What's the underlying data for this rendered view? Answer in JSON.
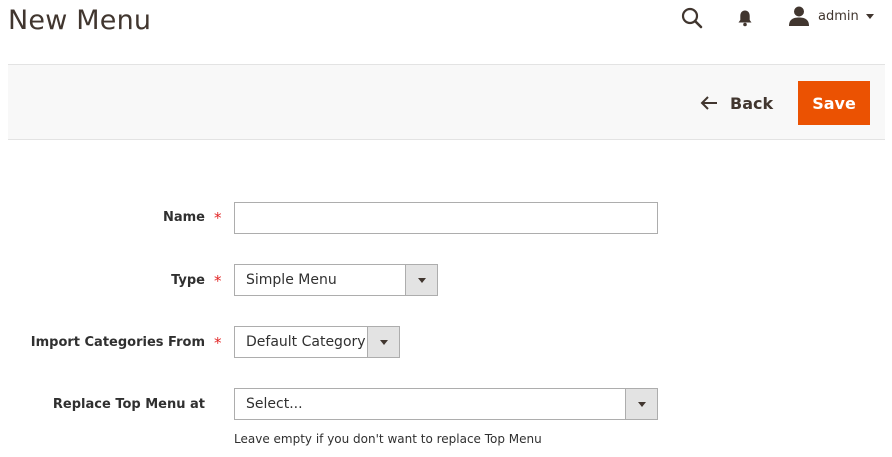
{
  "header": {
    "title": "New Menu",
    "user_name": "admin",
    "icons": {
      "search": "search-icon",
      "notifications": "bell-icon",
      "user": "user-icon",
      "dropdown": "chevron-down-icon"
    }
  },
  "actions": {
    "back_label": "Back",
    "save_label": "Save",
    "save_color": "#eb5202"
  },
  "form": {
    "name": {
      "label": "Name",
      "required_mark": "*",
      "value": ""
    },
    "type": {
      "label": "Type",
      "required_mark": "*",
      "selected": "Simple Menu"
    },
    "import_categories": {
      "label": "Import Categories From",
      "required_mark": "*",
      "selected": "Default Category"
    },
    "replace_top_menu": {
      "label": "Replace Top Menu at",
      "selected": "Select...",
      "note": "Leave empty if you don't want to replace Top Menu"
    }
  }
}
